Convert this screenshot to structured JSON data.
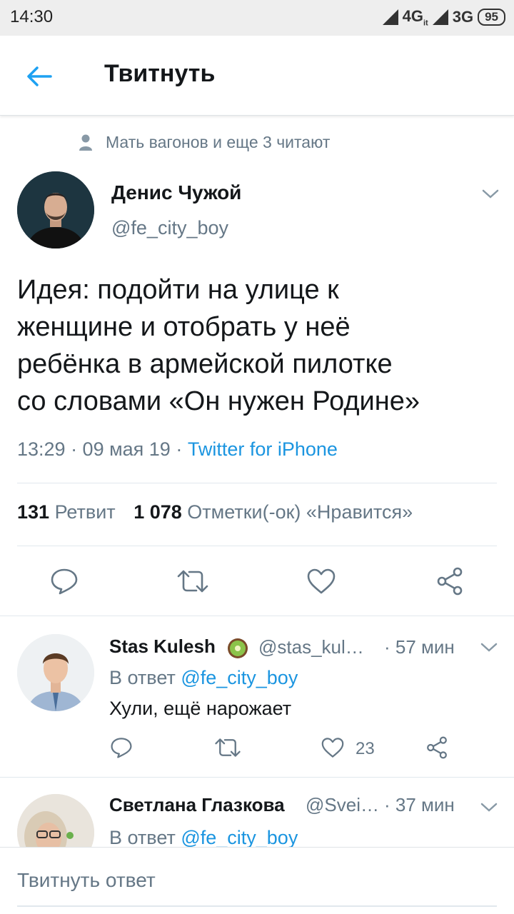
{
  "status_bar": {
    "time": "14:30",
    "net1": "4G",
    "net1_sub": "it",
    "net2": "3G",
    "battery": "95"
  },
  "app_bar": {
    "title": "Твитнуть",
    "back_icon": "arrow-left-icon"
  },
  "social_context": "Мать вагонов и еще 3 читают",
  "tweet": {
    "author_name": "Денис Чужой",
    "author_handle": "@fe_city_boy",
    "text": "Идея: подойти на улице к\nженщине и отобрать у неё\nребёнка в армейской пилотке\nсо словами «Он нужен Родине»",
    "time": "13:29 · 09 мая 19 · ",
    "source": "Twitter for iPhone",
    "retweets_count": "131",
    "retweets_label": "Ретвит",
    "likes_count": "1 078",
    "likes_label": "Отметки(-ок) «Нравится»"
  },
  "replies": [
    {
      "name": "Stas Kulesh",
      "badge_icon": "kiwi-icon",
      "handle": "@stas_kul…",
      "time": "· 57 мин",
      "reply_prefix": "В ответ ",
      "reply_to": "@fe_city_boy",
      "text": "Хули, ещё нарожает",
      "likes": "23"
    },
    {
      "name": "Светлана Глазкова",
      "handle": "@Svei…",
      "time": "· 37 мин",
      "reply_prefix": "В ответ ",
      "reply_to": "@fe_city_boy"
    }
  ],
  "compose": {
    "placeholder": "Твитнуть ответ"
  },
  "colors": {
    "accent": "#1b95e0",
    "secondary": "#657786",
    "text": "#14171a"
  }
}
